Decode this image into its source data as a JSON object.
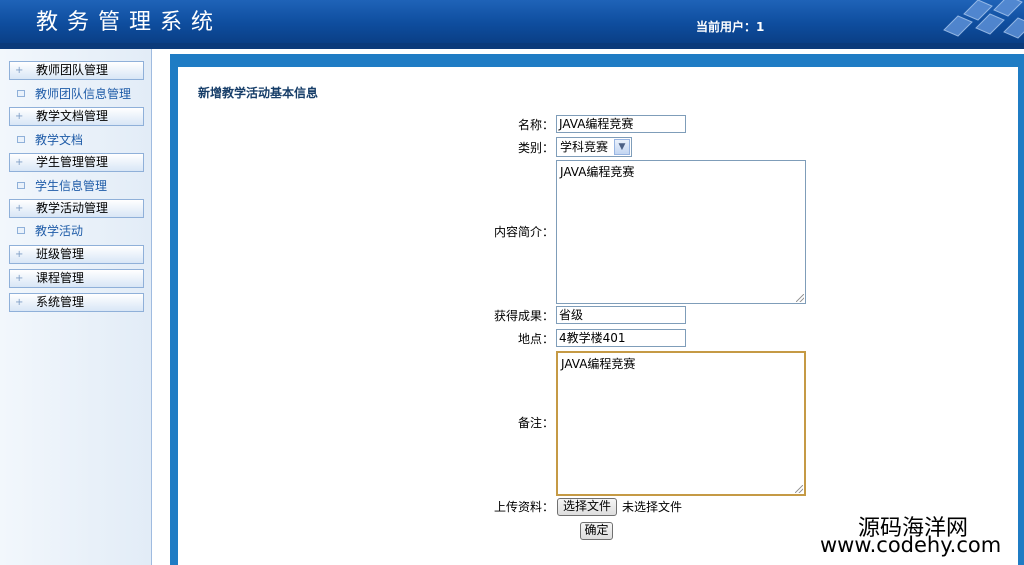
{
  "header": {
    "title": "教务管理系统",
    "user_label": "当前用户：1"
  },
  "sidebar": {
    "items": [
      {
        "type": "group",
        "label": "教师团队管理"
      },
      {
        "type": "sub",
        "label": "教师团队信息管理"
      },
      {
        "type": "group",
        "label": "教学文档管理"
      },
      {
        "type": "sub",
        "label": "教学文档"
      },
      {
        "type": "group",
        "label": "学生管理管理"
      },
      {
        "type": "sub",
        "label": "学生信息管理"
      },
      {
        "type": "group",
        "label": "教学活动管理"
      },
      {
        "type": "sub",
        "label": "教学活动"
      },
      {
        "type": "group",
        "label": "班级管理"
      },
      {
        "type": "group",
        "label": "课程管理"
      },
      {
        "type": "group",
        "label": "系统管理"
      }
    ]
  },
  "form": {
    "title": "新增教学活动基本信息",
    "name_label": "名称：",
    "name_value": "JAVA编程竞赛",
    "category_label": "类别：",
    "category_value": "学科竞赛",
    "intro_label": "内容简介：",
    "intro_value": "JAVA编程竞赛",
    "result_label": "获得成果：",
    "result_value": "省级",
    "location_label": "地点：",
    "location_value": "4教学楼401",
    "remark_label": "备注：",
    "remark_value": "JAVA编程竞赛",
    "upload_label": "上传资料：",
    "choose_file_label": "选择文件",
    "no_file_label": "未选择文件",
    "submit_label": "确定"
  },
  "watermark": {
    "line1": "源码海洋网",
    "line2": "www.codehy.com"
  }
}
